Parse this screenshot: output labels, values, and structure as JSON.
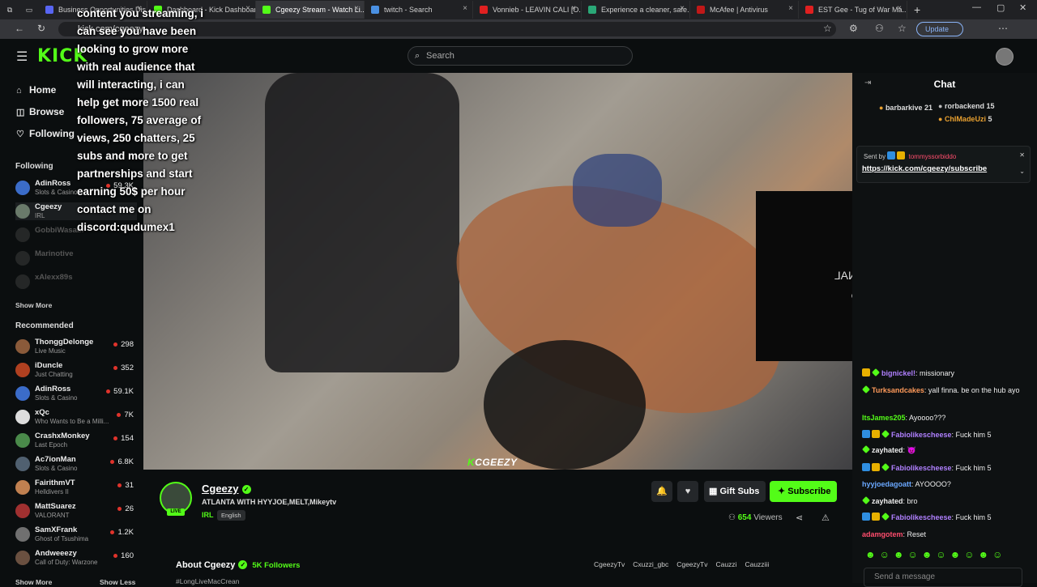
{
  "browser": {
    "tabs": [
      {
        "label": "Business Opportunities Dis...",
        "color": "#5865f2"
      },
      {
        "label": "Dashboard - Kick Dashboard",
        "color": "#53fc18"
      },
      {
        "label": "Cgeezy Stream - Watch Li...",
        "color": "#53fc18"
      },
      {
        "label": "twitch - Search",
        "color": "#4a90e2"
      },
      {
        "label": "Vonnieb - LEAVIN CALI [O...",
        "color": "#e02020"
      },
      {
        "label": "Experience a cleaner, safe...",
        "color": "#2aa877"
      },
      {
        "label": "McAfee | Antivirus",
        "color": "#c01818"
      },
      {
        "label": "EST Gee - Tug of War Ma...",
        "color": "#e02020"
      }
    ],
    "url": "kick.com/cgeezy",
    "update_label": "Update"
  },
  "kick": {
    "logo": "KICK",
    "search_placeholder": "Search"
  },
  "sidebar": {
    "nav": [
      {
        "label": "Home",
        "icon": "home-icon",
        "glyph": "⌂"
      },
      {
        "label": "Browse",
        "icon": "browse-icon",
        "glyph": "◫"
      },
      {
        "label": "Following",
        "icon": "heart-icon",
        "glyph": "♡"
      }
    ],
    "following_title": "Following",
    "following": [
      {
        "name": "AdinRoss",
        "sub": "Slots & Casino",
        "viewers": "59.3K",
        "color": "#3b6cc9"
      },
      {
        "name": "Cgeezy",
        "sub": "IRL",
        "viewers": "",
        "color": "#6a7a6a"
      },
      {
        "name": "GobbiWasabi",
        "sub": "",
        "viewers": "",
        "color": "#555"
      },
      {
        "name": "Marinotive",
        "sub": "",
        "viewers": "",
        "color": "#555"
      },
      {
        "name": "xAlexx89s",
        "sub": "",
        "viewers": "",
        "color": "#555"
      }
    ],
    "show_more": "Show More",
    "recommended_title": "Recommended",
    "recommended": [
      {
        "name": "ThonggDelonge",
        "sub": "Live Music",
        "viewers": "298",
        "color": "#8a5a3a"
      },
      {
        "name": "iDuncle",
        "sub": "Just Chatting",
        "viewers": "352",
        "color": "#b04020"
      },
      {
        "name": "AdinRoss",
        "sub": "Slots & Casino",
        "viewers": "59.1K",
        "color": "#3b6cc9"
      },
      {
        "name": "xQc",
        "sub": "Who Wants to Be a Milli...",
        "viewers": "7K",
        "color": "#ddd"
      },
      {
        "name": "CrashxMonkey",
        "sub": "Last Epoch",
        "viewers": "154",
        "color": "#4a8a4a"
      },
      {
        "name": "Ac7ionMan",
        "sub": "Slots & Casino",
        "viewers": "6.8K",
        "color": "#506070"
      },
      {
        "name": "FairithmVT",
        "sub": "Helldivers II",
        "viewers": "31",
        "color": "#c08050"
      },
      {
        "name": "MattSuarez",
        "sub": "VALORANT",
        "viewers": "26",
        "color": "#a03030"
      },
      {
        "name": "SamXFrank",
        "sub": "Ghost of Tsushima",
        "viewers": "1.2K",
        "color": "#707070"
      },
      {
        "name": "Andweeezy",
        "sub": "Call of Duty: Warzone",
        "viewers": "160",
        "color": "#6a5040"
      }
    ],
    "bottom_left": "Show More",
    "bottom_right": "Show Less"
  },
  "overlay_text": "content you streaming, i\ncan see you have been\nlooking to grow more\nwith real audience that\nwill interacting, i can\nhelp get more 1500 real\nfollowers, 75 average of\nviews, 250 chatters, 25\nsubs and more to get\npartnerships and start\nearning 50$ per hour\ncontact me on\ndiscord:qudumex1",
  "video": {
    "watermark_k": "K",
    "watermark": "CGEEZY",
    "no_signal": "NO SIGNAL",
    "elgato": "◎ elgato"
  },
  "stream": {
    "name": "Cgeezy",
    "verified": "✓",
    "live": "LIVE",
    "title": "ATLANTA WITH HYYJOE,MELT,Mikeytv",
    "category": "IRL",
    "language": "English",
    "gift_label": "Gift Subs",
    "subscribe_label": "Subscribe",
    "viewers": "654",
    "viewers_label": "Viewers",
    "about": "About Cgeezy",
    "followers": "5K Followers",
    "tag": "#LongLiveMacCrean",
    "socials": [
      "CgeezyTv",
      "Cxuzzi_gbc",
      "CgeezyTv",
      "Cauzzi",
      "Cauzziii"
    ]
  },
  "chat": {
    "title": "Chat",
    "leaders": [
      {
        "name": "barbarkive",
        "count": "21",
        "color": "#e8a030"
      },
      {
        "name": "rorbackend",
        "count": "15",
        "color": "#bbbbbb"
      },
      {
        "name": "ChIMadeUzi",
        "count": "5",
        "color": "#e8a030"
      }
    ],
    "pinned_by": "Sent by",
    "pinned_user": "tommyssorbiddo",
    "pinned_link": "https://kick.com/cgeezy/subscribe",
    "messages": [
      {
        "user": "bignickel!",
        "color": "#b080ff",
        "text": ": missionary",
        "badges": 2
      },
      {
        "user": "Turksandcakes",
        "color": "#ff9a5a",
        "text": ": yall finna. be on the hub ayo",
        "badges": 1
      },
      {
        "user": "ItsJames205",
        "color": "#53fc18",
        "text": ": Ayoooo???",
        "badges": 0
      },
      {
        "user": "Fabiolikescheese",
        "color": "#b080ff",
        "text": ": Fuck him 5",
        "badges": 3
      },
      {
        "user": "zayhated",
        "color": "#eeeeee",
        "text": ": 😈",
        "badges": 1
      },
      {
        "user": "Fabiolikescheese",
        "color": "#b080ff",
        "text": ": Fuck him 5",
        "badges": 3
      },
      {
        "user": "hyyjoedagoatt",
        "color": "#6aa8ff",
        "text": ": AYOOOO?",
        "badges": 0
      },
      {
        "user": "zayhated",
        "color": "#eeeeee",
        "text": ": bro",
        "badges": 1
      },
      {
        "user": "Fabiolikescheese",
        "color": "#b080ff",
        "text": ": Fuck him 5",
        "badges": 3
      },
      {
        "user": "adamgotem",
        "color": "#ff4d6d",
        "text": ": Reset",
        "badges": 0
      }
    ],
    "emotes": "☻☺☻☺☻☺☻☺☻☺",
    "send_placeholder": "Send a message"
  }
}
